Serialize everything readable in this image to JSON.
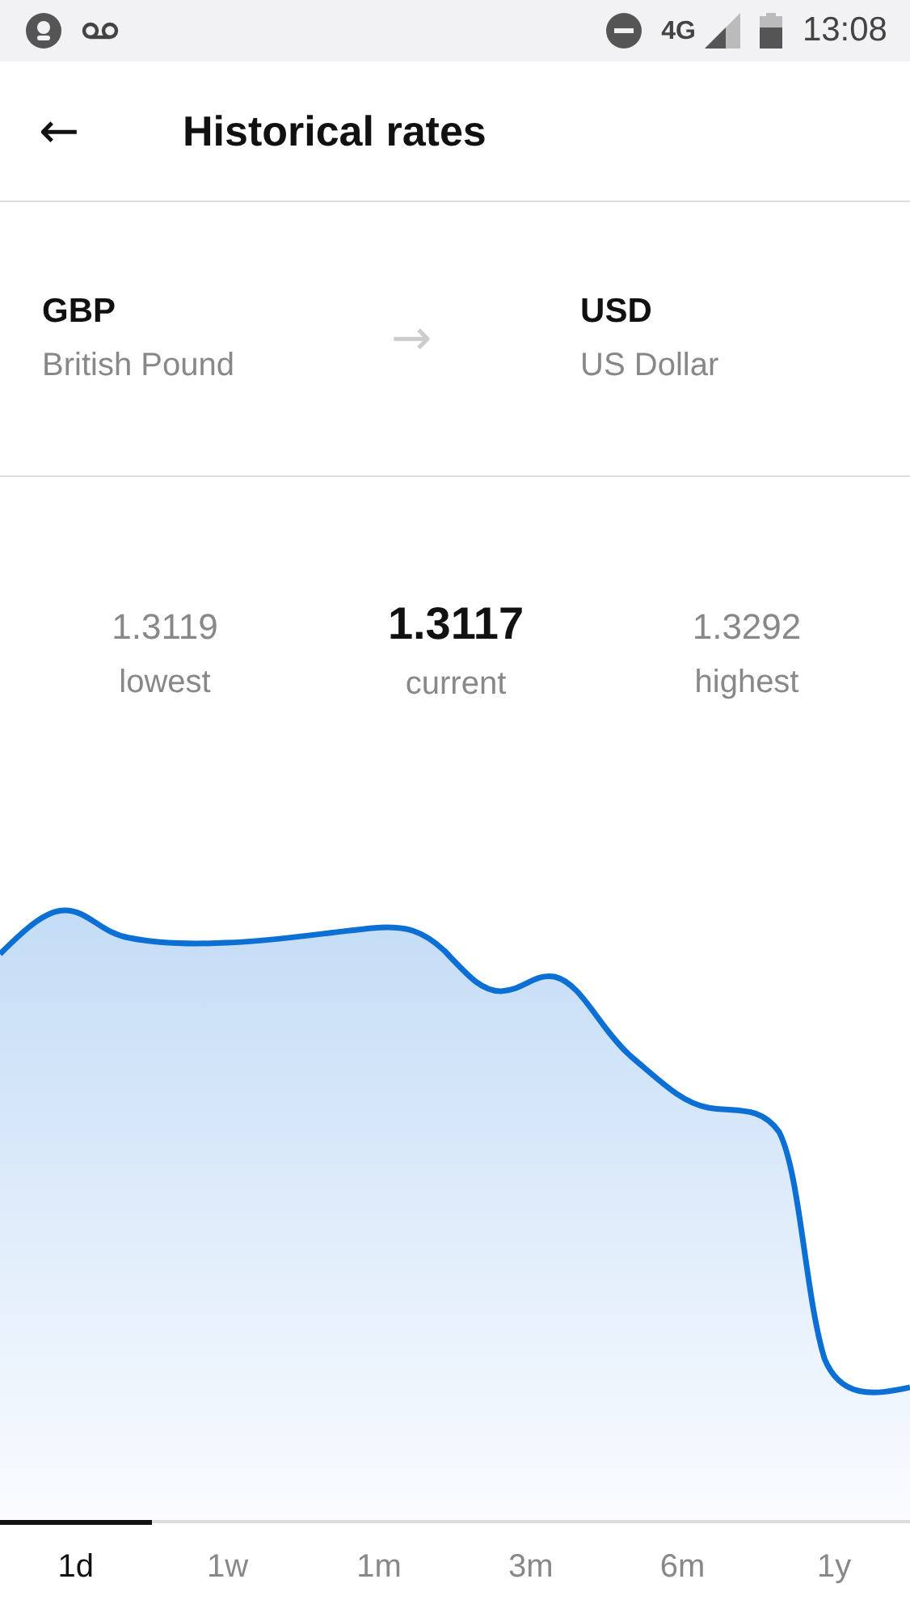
{
  "status_bar": {
    "network": "4G",
    "time": "13:08"
  },
  "header": {
    "back": "←",
    "title": "Historical rates"
  },
  "pair": {
    "from": {
      "code": "GBP",
      "name": "British Pound"
    },
    "arrow": "→",
    "to": {
      "code": "USD",
      "name": "US Dollar"
    }
  },
  "stats": [
    {
      "value": "1.3119",
      "label": "lowest",
      "kind": "plain"
    },
    {
      "value": "1.3117",
      "label": "current",
      "kind": "main"
    },
    {
      "value": "1.3292",
      "label": "highest",
      "kind": "plain"
    }
  ],
  "tabs": [
    {
      "label": "1d",
      "selected": true
    },
    {
      "label": "1w",
      "selected": false
    },
    {
      "label": "1m",
      "selected": false
    },
    {
      "label": "3m",
      "selected": false
    },
    {
      "label": "6m",
      "selected": false
    },
    {
      "label": "1y",
      "selected": false
    }
  ]
}
